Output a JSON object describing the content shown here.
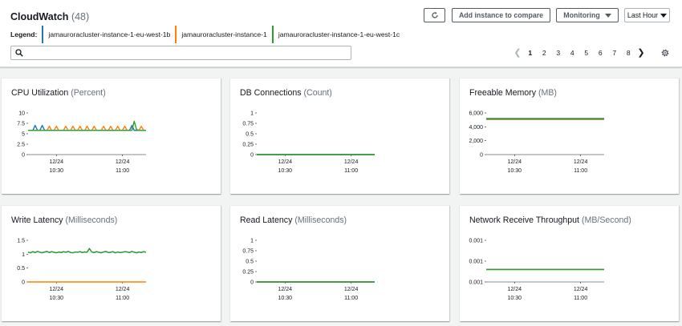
{
  "header": {
    "title": "CloudWatch",
    "count": "(48)",
    "legend_label": "Legend:",
    "legend": [
      {
        "name": "jamauroracluster-instance-1-eu-west-1b",
        "color": "#1f77b4"
      },
      {
        "name": "jamauroracluster-instance-1",
        "color": "#ff7f0e"
      },
      {
        "name": "jamauroracluster-instance-1-eu-west-1c",
        "color": "#2ca02c"
      }
    ],
    "search_placeholder": "",
    "buttons": {
      "add": "Add instance to compare",
      "monitoring": "Monitoring",
      "last_hour": "Last Hour"
    },
    "pagination": {
      "pages": [
        "1",
        "2",
        "3",
        "4",
        "5",
        "6",
        "7",
        "8"
      ],
      "current": "1"
    }
  },
  "colors": {
    "blue": "#1f77b4",
    "orange": "#ff7f0e",
    "green": "#2ca02c"
  },
  "chart_data": [
    {
      "type": "line",
      "title": "CPU Utilization",
      "unit": "(Percent)",
      "yticks": [
        "10",
        "7.5",
        "5",
        "2.5",
        "0"
      ],
      "ylim": [
        0,
        10
      ],
      "xticks": [
        {
          "date": "12/24",
          "time": "10:30"
        },
        {
          "date": "12/24",
          "time": "11:00"
        }
      ],
      "series": [
        {
          "name": "jamauroracluster-instance-1-eu-west-1b",
          "values": [
            5.8,
            5.8,
            5.8,
            7.0,
            5.8,
            5.8,
            7.0,
            5.8,
            5.8,
            5.8,
            5.8,
            5.8,
            5.8,
            5.8,
            5.8,
            5.8,
            5.8,
            5.8,
            5.8,
            5.8,
            5.8,
            5.8,
            5.8,
            5.8,
            5.8,
            5.8,
            5.8,
            5.8,
            5.8,
            5.8,
            5.8,
            5.8,
            5.8,
            5.8,
            5.8,
            5.8,
            5.8,
            5.8,
            5.8,
            5.8,
            5.8,
            5.8,
            5.8,
            5.8,
            7.0,
            5.8,
            5.8,
            5.8,
            5.8,
            5.8,
            5.8
          ]
        },
        {
          "name": "jamauroracluster-instance-1",
          "values": [
            5.8,
            5.8,
            5.8,
            5.8,
            5.8,
            5.8,
            5.8,
            5.8,
            5.8,
            6.8,
            5.8,
            5.8,
            6.8,
            5.8,
            5.8,
            5.8,
            6.8,
            5.8,
            5.8,
            6.8,
            5.8,
            5.8,
            6.8,
            5.8,
            5.8,
            6.8,
            5.8,
            5.8,
            6.8,
            5.8,
            5.8,
            5.8,
            6.8,
            5.8,
            5.8,
            6.8,
            5.8,
            5.8,
            6.8,
            5.8,
            5.8,
            6.8,
            5.8,
            5.8,
            6.8,
            5.8,
            5.8,
            5.8,
            6.8,
            5.8,
            5.8
          ]
        },
        {
          "name": "jamauroracluster-instance-1-eu-west-1c",
          "values": [
            5.8,
            5.8,
            5.8,
            5.8,
            5.8,
            5.8,
            5.8,
            5.8,
            5.8,
            5.8,
            5.8,
            5.8,
            5.8,
            5.8,
            5.8,
            5.8,
            5.8,
            5.8,
            5.8,
            5.8,
            5.8,
            5.8,
            5.8,
            5.8,
            5.8,
            5.8,
            5.8,
            5.8,
            5.8,
            5.8,
            5.8,
            5.8,
            5.8,
            5.8,
            5.8,
            5.8,
            5.8,
            5.8,
            5.8,
            5.8,
            5.8,
            5.8,
            5.8,
            5.8,
            5.8,
            8.0,
            6.0,
            5.8,
            5.8,
            5.8,
            5.8
          ]
        }
      ]
    },
    {
      "type": "line",
      "title": "DB Connections",
      "unit": "(Count)",
      "yticks": [
        "1",
        "0.75",
        "0.5",
        "0.25",
        "0"
      ],
      "ylim": [
        0,
        1
      ],
      "xticks": [
        {
          "date": "12/24",
          "time": "10:30"
        },
        {
          "date": "12/24",
          "time": "11:00"
        }
      ],
      "series": [
        {
          "name": "jamauroracluster-instance-1-eu-west-1b",
          "values": [
            0,
            0
          ]
        },
        {
          "name": "jamauroracluster-instance-1",
          "values": [
            0,
            0
          ]
        },
        {
          "name": "jamauroracluster-instance-1-eu-west-1c",
          "values": [
            0,
            0
          ]
        }
      ]
    },
    {
      "type": "line",
      "title": "Freeable Memory",
      "unit": "(MB)",
      "yticks": [
        "6,000",
        "4,000",
        "2,000",
        "0"
      ],
      "ylim": [
        0,
        6000
      ],
      "xticks": [
        {
          "date": "12/24",
          "time": "10:30"
        },
        {
          "date": "12/24",
          "time": "11:00"
        }
      ],
      "series": [
        {
          "name": "jamauroracluster-instance-1-eu-west-1b",
          "values": [
            5200,
            5200
          ]
        },
        {
          "name": "jamauroracluster-instance-1",
          "values": [
            5050,
            5050
          ]
        },
        {
          "name": "jamauroracluster-instance-1-eu-west-1c",
          "values": [
            5130,
            5130
          ]
        }
      ]
    },
    {
      "type": "line",
      "title": "Write Latency",
      "unit": "(Milliseconds)",
      "yticks": [
        "1.5",
        "1",
        "0.5",
        "0"
      ],
      "ylim": [
        0,
        1.5
      ],
      "xticks": [
        {
          "date": "12/24",
          "time": "10:30"
        },
        {
          "date": "12/24",
          "time": "11:00"
        }
      ],
      "series": [
        {
          "name": "jamauroracluster-instance-1-eu-west-1b",
          "values": [
            1.07,
            1.05,
            1.09,
            1.06,
            1.1,
            1.07,
            1.05,
            1.08,
            1.1,
            1.06,
            1.09,
            1.07,
            1.05,
            1.08,
            1.06,
            1.09,
            1.07,
            1.1,
            1.06,
            1.05,
            1.08,
            1.07,
            1.09,
            1.06,
            1.08,
            1.07,
            1.2,
            1.08,
            1.06,
            1.09,
            1.07,
            1.05,
            1.08,
            1.1,
            1.06,
            1.07,
            1.09,
            1.05,
            1.08,
            1.06,
            1.07,
            1.09,
            1.08,
            1.06,
            1.1,
            1.07,
            1.05,
            1.08,
            1.06,
            1.09,
            1.07
          ]
        },
        {
          "name": "jamauroracluster-instance-1",
          "values": [
            0,
            0
          ]
        },
        {
          "name": "jamauroracluster-instance-1-eu-west-1c",
          "values": [
            1.07,
            1.05,
            1.09,
            1.06,
            1.1,
            1.07,
            1.05,
            1.08,
            1.1,
            1.06,
            1.09,
            1.07,
            1.05,
            1.08,
            1.06,
            1.09,
            1.07,
            1.1,
            1.06,
            1.05,
            1.08,
            1.07,
            1.09,
            1.06,
            1.08,
            1.07,
            1.2,
            1.08,
            1.06,
            1.09,
            1.07,
            1.05,
            1.08,
            1.1,
            1.06,
            1.07,
            1.09,
            1.05,
            1.08,
            1.06,
            1.07,
            1.09,
            1.08,
            1.06,
            1.1,
            1.07,
            1.05,
            1.08,
            1.06,
            1.09,
            1.07
          ]
        }
      ]
    },
    {
      "type": "line",
      "title": "Read Latency",
      "unit": "(Milliseconds)",
      "yticks": [
        "1",
        "0.75",
        "0.5",
        "0.25",
        "0"
      ],
      "ylim": [
        0,
        1
      ],
      "xticks": [
        {
          "date": "12/24",
          "time": "10:30"
        },
        {
          "date": "12/24",
          "time": "11:00"
        }
      ],
      "series": [
        {
          "name": "jamauroracluster-instance-1-eu-west-1b",
          "values": [
            0,
            0
          ]
        },
        {
          "name": "jamauroracluster-instance-1",
          "values": [
            0,
            0
          ]
        },
        {
          "name": "jamauroracluster-instance-1-eu-west-1c",
          "values": [
            0,
            0
          ]
        }
      ]
    },
    {
      "type": "line",
      "title": "Network Receive Throughput",
      "unit": "(MB/Second)",
      "yticks": [
        "0.001",
        "0.001",
        "0.001"
      ],
      "ylim": [
        0.0009,
        0.0012
      ],
      "xticks": [
        {
          "date": "12/24",
          "time": "10:30"
        },
        {
          "date": "12/24",
          "time": "11:00"
        }
      ],
      "series": [
        {
          "name": "jamauroracluster-instance-1-eu-west-1b",
          "values": [
            0.00099,
            0.00099,
            0.00099,
            0.00099,
            0.00099,
            0.00099,
            0.00099,
            0.00099,
            0.00099,
            0.00099,
            0.00099,
            0.00099,
            0.00099,
            0.00099,
            0.00099,
            0.00099,
            0.00099,
            0.00099,
            0.00099,
            0.00099,
            0.00099,
            0.00099,
            0.00099,
            0.00099,
            0.00099,
            0.00099,
            0.00099,
            0.00099,
            0.00099,
            0.00099,
            0.00099,
            0.00099,
            0.00099,
            0.00099,
            0.00099,
            0.00099,
            0.00099,
            0.00099,
            0.00099,
            0.00099,
            0.00099,
            0.00099,
            0.00099,
            0.00099,
            0.00099,
            0.00099,
            0.00099,
            0.00099,
            0.00099,
            0.00099,
            0.00099
          ]
        },
        {
          "name": "jamauroracluster-instance-1",
          "values": [
            0.00099,
            0.00099,
            0.00099,
            0.00099,
            0.00099,
            0.00099,
            0.00099,
            0.00099,
            0.00099,
            0.00099,
            0.00099,
            0.00099,
            0.00099,
            0.00099,
            0.00099,
            0.00099,
            0.00099,
            0.00099,
            0.00099,
            0.00099,
            0.00099,
            0.00099,
            0.00099,
            0.00099,
            0.00099,
            0.00099,
            0.00099,
            0.00099,
            0.00099,
            0.00099,
            0.00099,
            0.00099,
            0.00099,
            0.00099,
            0.00099,
            0.00099,
            0.00099,
            0.00099,
            0.00099,
            0.00099,
            0.00099,
            0.00099,
            0.00099,
            0.00099,
            0.00099,
            0.00099,
            0.00099,
            0.00099,
            0.00099,
            0.00099,
            0.00099
          ]
        },
        {
          "name": "jamauroracluster-instance-1-eu-west-1c",
          "values": [
            0.00099,
            0.00099,
            0.00099,
            0.00099,
            0.00099,
            0.00099,
            0.00099,
            0.00099,
            0.00099,
            0.00099,
            0.00099,
            0.00099,
            0.00099,
            0.00099,
            0.00099,
            0.00099,
            0.00099,
            0.00099,
            0.00099,
            0.00099,
            0.00099,
            0.00099,
            0.00099,
            0.00099,
            0.00099,
            0.00099,
            0.00099,
            0.00099,
            0.00099,
            0.00099,
            0.00099,
            0.00099,
            0.00099,
            0.00099,
            0.00099,
            0.00099,
            0.00099,
            0.00099,
            0.00099,
            0.00099,
            0.00099,
            0.00099,
            0.00099,
            0.00099,
            0.00099,
            0.00099,
            0.00099,
            0.00099,
            0.00099,
            0.00099,
            0.00099
          ]
        }
      ]
    }
  ]
}
